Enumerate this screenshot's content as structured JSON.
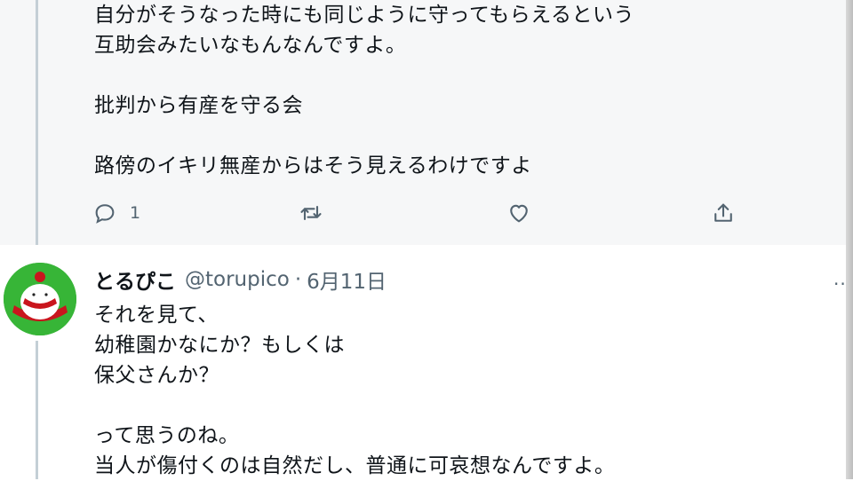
{
  "prev_tweet": {
    "lines": [
      "自分がそうなった時にも同じように守ってもらえるという",
      "互助会みたいなもんなんですよ。",
      "",
      "批判から有産を守る会",
      "",
      "路傍のイキリ無産からはそう見えるわけですよ"
    ],
    "actions": {
      "reply_count": "1",
      "retweet_count": "",
      "like_count": ""
    }
  },
  "tweet": {
    "author_name": "とるぴこ",
    "handle": "@torupico",
    "separator": "·",
    "date": "6月11日",
    "lines": [
      "それを見て、",
      "幼稚園かなにか？もしくは",
      "保父さんか？",
      "",
      "って思うのね。",
      "当人が傷付くのは自然だし、普通に可哀想なんですよ。"
    ]
  },
  "icons": {
    "reply": "reply-icon",
    "retweet": "retweet-icon",
    "like": "heart-icon",
    "share": "share-icon",
    "more": "more-icon"
  },
  "colors": {
    "muted": "#536471",
    "text": "#0f1419",
    "avatar_bg": "#37b537"
  }
}
